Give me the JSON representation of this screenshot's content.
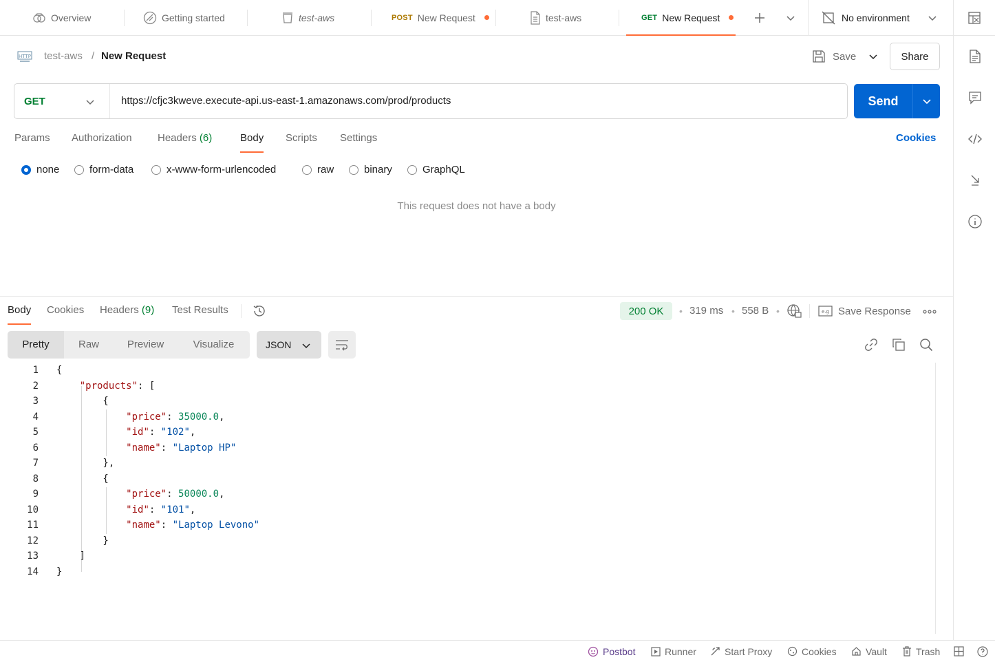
{
  "tabs": {
    "overview": "Overview",
    "getting_started": "Getting started",
    "collection1": "test-aws",
    "post_method": "POST",
    "post_label": "New Request",
    "collection2": "test-aws",
    "get_method": "GET",
    "get_label": "New Request",
    "environment": "No environment"
  },
  "breadcrumb": {
    "collection": "test-aws",
    "separator": "/",
    "request": "New Request"
  },
  "header": {
    "save_label": "Save",
    "share_label": "Share"
  },
  "request": {
    "method": "GET",
    "url": "https://cfjc3kweve.execute-api.us-east-1.amazonaws.com/prod/products",
    "send_label": "Send",
    "tabs": {
      "params": "Params",
      "authorization": "Authorization",
      "headers": "Headers",
      "headers_count": "(6)",
      "body": "Body",
      "scripts": "Scripts",
      "settings": "Settings"
    },
    "cookies_link": "Cookies",
    "body_types": {
      "none": "none",
      "form_data": "form-data",
      "urlencoded": "x-www-form-urlencoded",
      "raw": "raw",
      "binary": "binary",
      "graphql": "GraphQL"
    },
    "no_body_message": "This request does not have a body"
  },
  "response": {
    "tabs": {
      "body": "Body",
      "cookies": "Cookies",
      "headers": "Headers",
      "headers_count": "(9)",
      "test_results": "Test Results"
    },
    "status": "200 OK",
    "time": "319 ms",
    "size": "558 B",
    "save_response": "Save Response",
    "views": {
      "pretty": "Pretty",
      "raw": "Raw",
      "preview": "Preview",
      "visualize": "Visualize"
    },
    "format": "JSON",
    "lines": [
      {
        "n": "1",
        "t": [
          [
            "p",
            "{"
          ]
        ]
      },
      {
        "n": "2",
        "t": [
          [
            "p",
            "    "
          ],
          [
            "k",
            "\"products\""
          ],
          [
            "p",
            ": ["
          ]
        ]
      },
      {
        "n": "3",
        "t": [
          [
            "p",
            "        {"
          ]
        ]
      },
      {
        "n": "4",
        "t": [
          [
            "p",
            "            "
          ],
          [
            "k",
            "\"price\""
          ],
          [
            "p",
            ": "
          ],
          [
            "n",
            "35000.0"
          ],
          [
            "p",
            ","
          ]
        ]
      },
      {
        "n": "5",
        "t": [
          [
            "p",
            "            "
          ],
          [
            "k",
            "\"id\""
          ],
          [
            "p",
            ": "
          ],
          [
            "s",
            "\"102\""
          ],
          [
            "p",
            ","
          ]
        ]
      },
      {
        "n": "6",
        "t": [
          [
            "p",
            "            "
          ],
          [
            "k",
            "\"name\""
          ],
          [
            "p",
            ": "
          ],
          [
            "s",
            "\"Laptop HP\""
          ]
        ]
      },
      {
        "n": "7",
        "t": [
          [
            "p",
            "        },"
          ]
        ]
      },
      {
        "n": "8",
        "t": [
          [
            "p",
            "        {"
          ]
        ]
      },
      {
        "n": "9",
        "t": [
          [
            "p",
            "            "
          ],
          [
            "k",
            "\"price\""
          ],
          [
            "p",
            ": "
          ],
          [
            "n",
            "50000.0"
          ],
          [
            "p",
            ","
          ]
        ]
      },
      {
        "n": "10",
        "t": [
          [
            "p",
            "            "
          ],
          [
            "k",
            "\"id\""
          ],
          [
            "p",
            ": "
          ],
          [
            "s",
            "\"101\""
          ],
          [
            "p",
            ","
          ]
        ]
      },
      {
        "n": "11",
        "t": [
          [
            "p",
            "            "
          ],
          [
            "k",
            "\"name\""
          ],
          [
            "p",
            ": "
          ],
          [
            "s",
            "\"Laptop Levono\""
          ]
        ]
      },
      {
        "n": "12",
        "t": [
          [
            "p",
            "        }"
          ]
        ]
      },
      {
        "n": "13",
        "t": [
          [
            "p",
            "    ]"
          ]
        ]
      },
      {
        "n": "14",
        "t": [
          [
            "p",
            "}"
          ]
        ]
      }
    ]
  },
  "footer": {
    "postbot": "Postbot",
    "runner": "Runner",
    "start_proxy": "Start Proxy",
    "cookies": "Cookies",
    "vault": "Vault",
    "trash": "Trash"
  },
  "colors": {
    "accent": "#ff6c37",
    "send_blue": "#0265d2",
    "get_green": "#007f31",
    "post_amber": "#ad7a03",
    "status_bg": "#e5f4ea"
  }
}
